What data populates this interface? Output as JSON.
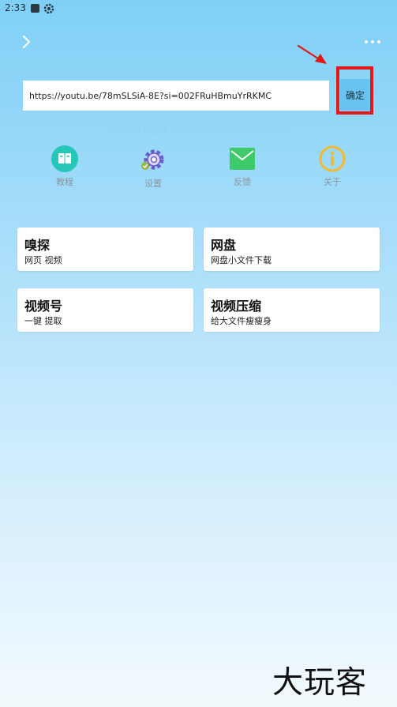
{
  "status_bar": {
    "time": "2:33",
    "icons": [
      "a-app-icon",
      "gear-app-icon"
    ]
  },
  "toolbar": {
    "back_icon": "chevron-right-icon",
    "more_icon": "more-dots-icon"
  },
  "url_input": {
    "value": "https://youtu.be/78mSLSiA-8E?si=002FRuHBmuYrRKMC"
  },
  "confirm": {
    "label": "确定"
  },
  "hint": {
    "text": "这次是真的解决了，具体情况可以点击查看文章"
  },
  "quick_actions": [
    {
      "label": "教程",
      "icon": "book-icon",
      "color": "#26c6b8"
    },
    {
      "label": "设置",
      "icon": "gear-icon",
      "color": "#6a5acd"
    },
    {
      "label": "反馈",
      "icon": "mail-icon",
      "color": "#3ecb6b"
    },
    {
      "label": "关于",
      "icon": "info-icon",
      "color": "#f5b82e"
    }
  ],
  "cards": [
    {
      "title": "嗅探",
      "subtitle": "网页 视频"
    },
    {
      "title": "网盘",
      "subtitle": "网盘小文件下载"
    },
    {
      "title": "视频号",
      "subtitle": "一键 提取"
    },
    {
      "title": "视频压缩",
      "subtitle": "给大文件瘦瘦身"
    }
  ],
  "watermark": {
    "text": "大玩客"
  },
  "colors": {
    "highlight_box": "#e01919",
    "confirm_bg": "#69c3f2",
    "hint_text": "#8fd5f5"
  }
}
